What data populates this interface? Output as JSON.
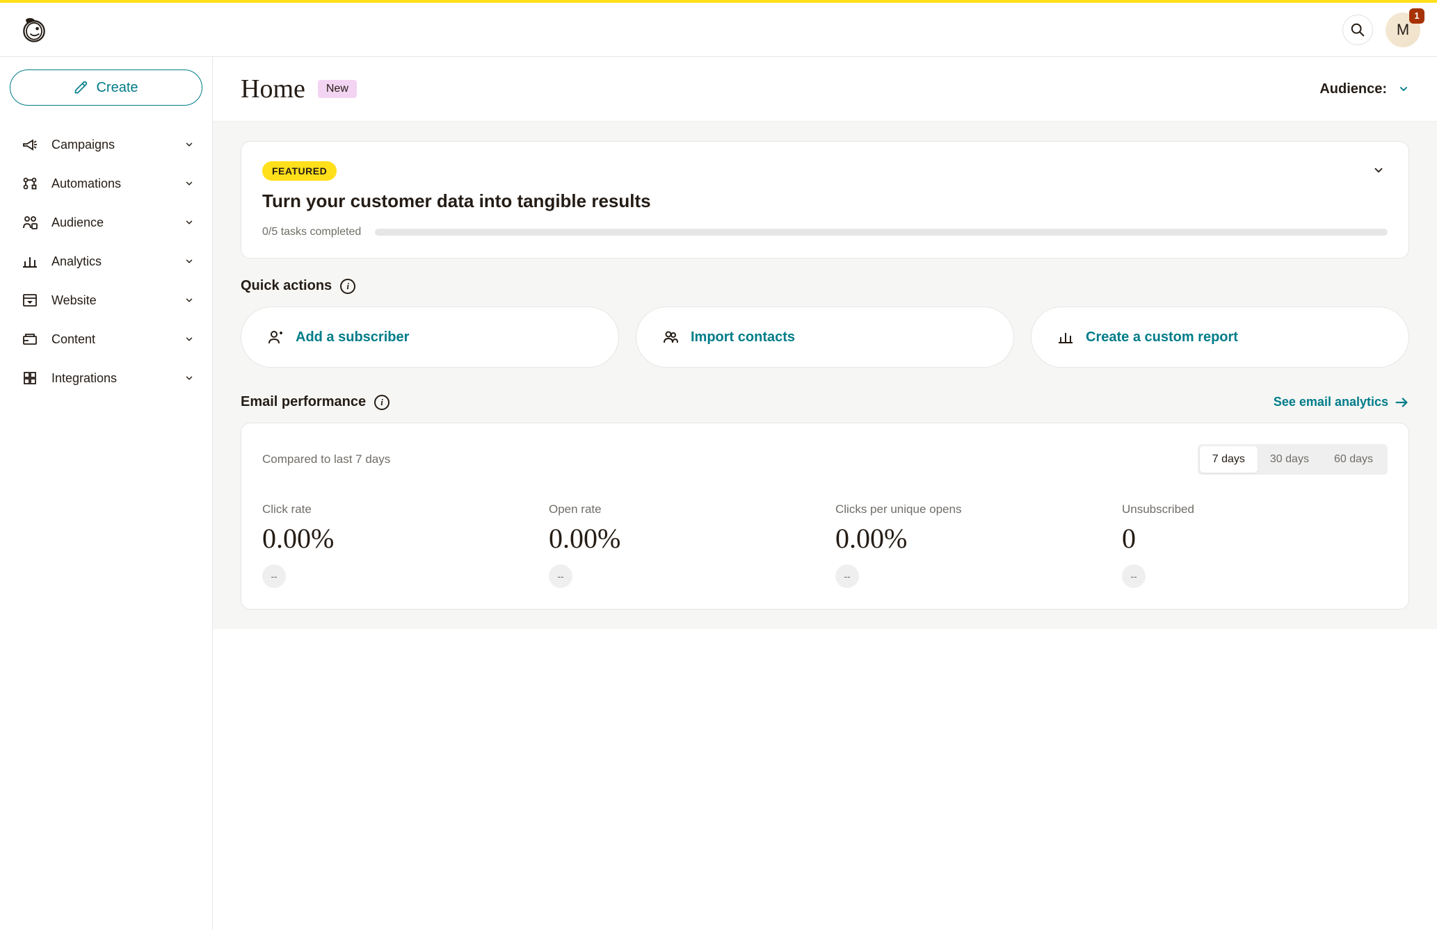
{
  "header": {
    "avatar_letter": "M",
    "notification_count": "1"
  },
  "sidebar": {
    "create_label": "Create",
    "items": [
      {
        "label": "Campaigns"
      },
      {
        "label": "Automations"
      },
      {
        "label": "Audience"
      },
      {
        "label": "Analytics"
      },
      {
        "label": "Website"
      },
      {
        "label": "Content"
      },
      {
        "label": "Integrations"
      }
    ]
  },
  "page": {
    "title": "Home",
    "new_badge": "New",
    "audience_label": "Audience:"
  },
  "featured": {
    "badge": "FEATURED",
    "title": "Turn your customer data into tangible results",
    "progress_text": "0/5 tasks completed"
  },
  "quick_actions": {
    "title": "Quick actions",
    "items": [
      {
        "label": "Add a subscriber"
      },
      {
        "label": "Import contacts"
      },
      {
        "label": "Create a custom report"
      }
    ]
  },
  "email_perf": {
    "title": "Email performance",
    "link_label": "See email analytics",
    "compared_text": "Compared to last 7 days",
    "ranges": [
      "7 days",
      "30 days",
      "60 days"
    ],
    "active_range_index": 0,
    "metrics": [
      {
        "label": "Click rate",
        "value": "0.00%",
        "change": "--"
      },
      {
        "label": "Open rate",
        "value": "0.00%",
        "change": "--"
      },
      {
        "label": "Clicks per unique opens",
        "value": "0.00%",
        "change": "--"
      },
      {
        "label": "Unsubscribed",
        "value": "0",
        "change": "--"
      }
    ]
  }
}
